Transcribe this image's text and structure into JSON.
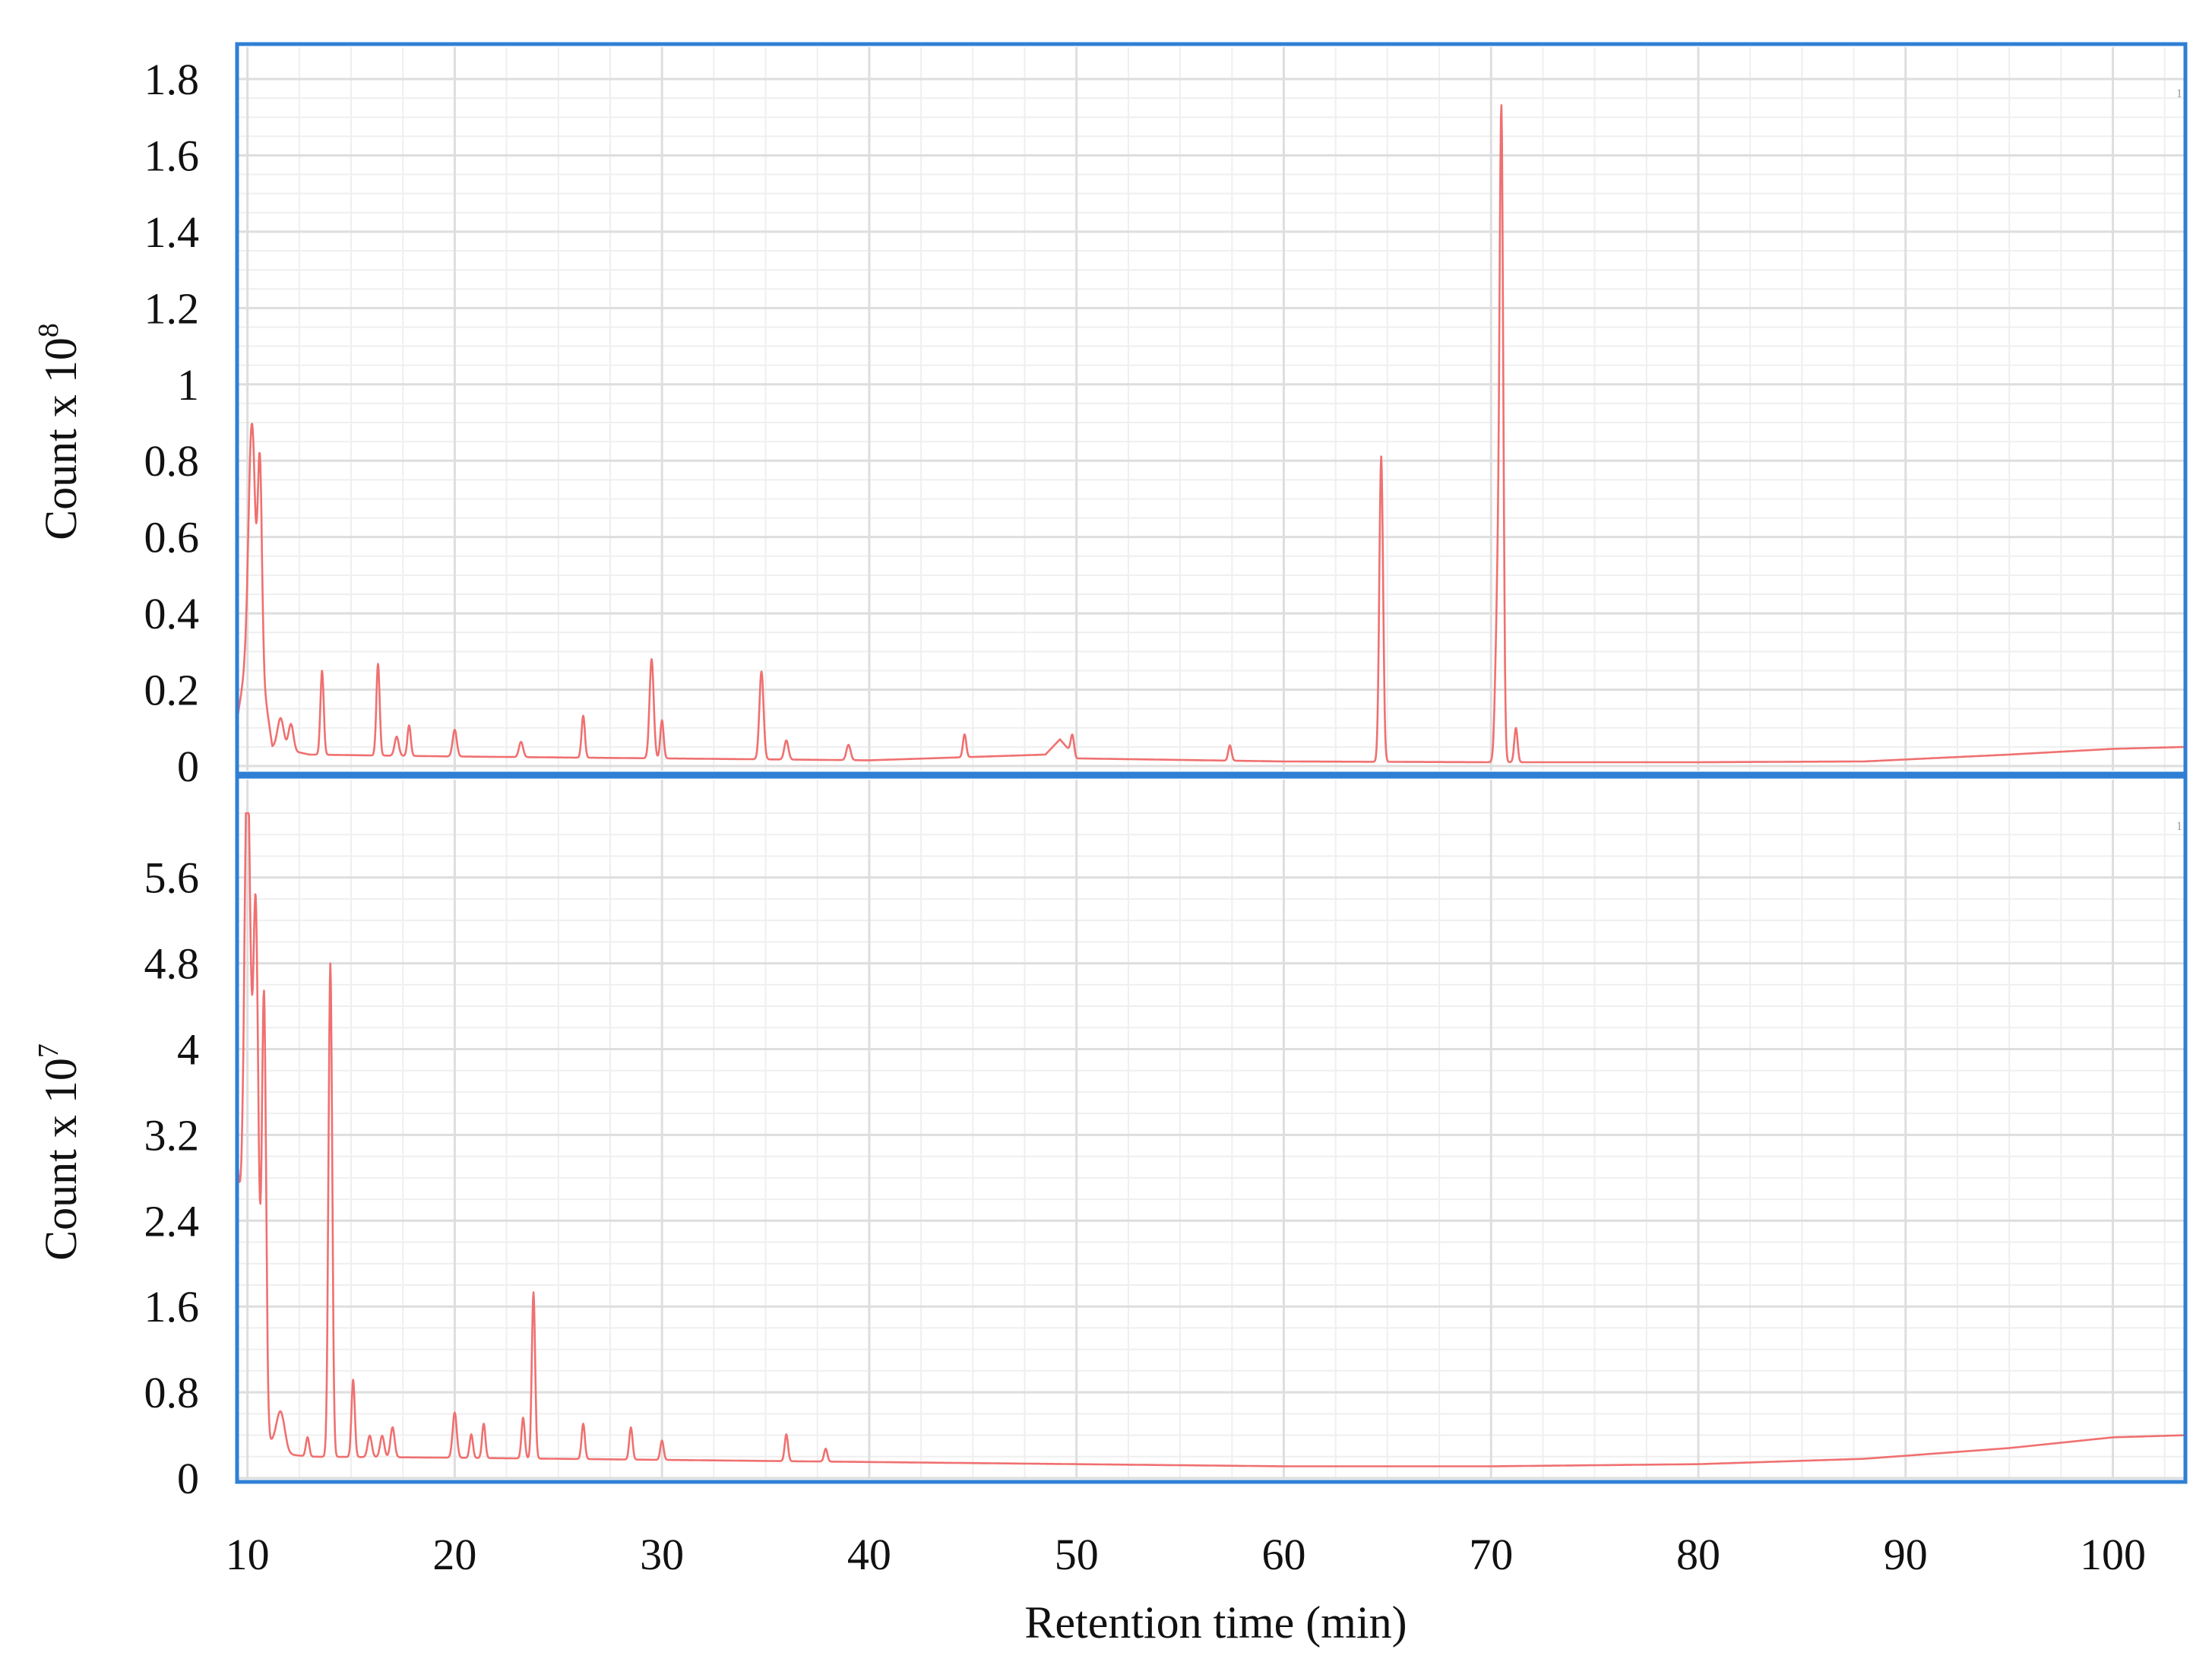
{
  "colors": {
    "frame": "#2f7fd4",
    "trace": "#f07070",
    "grid_major": "#dedede",
    "grid_minor": "#efefef"
  },
  "xaxis": {
    "label": "Retention time (min)",
    "ticks": [
      "10",
      "20",
      "30",
      "40",
      "50",
      "60",
      "70",
      "80",
      "90",
      "100"
    ],
    "range": [
      9.5,
      103.5
    ]
  },
  "chart_data": [
    {
      "type": "line",
      "ylabel": {
        "text": "Count x 10",
        "exp": "8"
      },
      "corner_marker": "1",
      "ylim": [
        0,
        1.8
      ],
      "yticks": [
        0,
        0.2,
        0.4,
        0.6,
        0.8,
        1.0,
        1.2,
        1.4,
        1.6,
        1.8
      ],
      "ytick_labels": [
        "0",
        "0.2",
        "0.4",
        "0.6",
        "0.8",
        "1",
        "1.2",
        "1.4",
        "1.6",
        "1.8"
      ],
      "baseline": [
        [
          9.5,
          0.12
        ],
        [
          10.3,
          0.4
        ],
        [
          11.2,
          0.05
        ],
        [
          13,
          0.03
        ],
        [
          20,
          0.025
        ],
        [
          30,
          0.02
        ],
        [
          40,
          0.015
        ],
        [
          48.5,
          0.03
        ],
        [
          49.2,
          0.07
        ],
        [
          50,
          0.02
        ],
        [
          60,
          0.012
        ],
        [
          70,
          0.01
        ],
        [
          80,
          0.01
        ],
        [
          88,
          0.012
        ],
        [
          95,
          0.03
        ],
        [
          100,
          0.045
        ],
        [
          103.5,
          0.05
        ]
      ],
      "peaks": [
        [
          10.2,
          0.53,
          0.15
        ],
        [
          10.6,
          0.52,
          0.1
        ],
        [
          11.6,
          0.08,
          0.15
        ],
        [
          12.1,
          0.07,
          0.12
        ],
        [
          13.6,
          0.22,
          0.08
        ],
        [
          16.3,
          0.24,
          0.08
        ],
        [
          17.2,
          0.05,
          0.1
        ],
        [
          17.8,
          0.08,
          0.08
        ],
        [
          20.0,
          0.07,
          0.1
        ],
        [
          23.2,
          0.04,
          0.1
        ],
        [
          26.2,
          0.11,
          0.08
        ],
        [
          29.5,
          0.26,
          0.1
        ],
        [
          30.0,
          0.1,
          0.08
        ],
        [
          34.8,
          0.23,
          0.1
        ],
        [
          36.0,
          0.05,
          0.1
        ],
        [
          39.0,
          0.04,
          0.1
        ],
        [
          44.6,
          0.06,
          0.08
        ],
        [
          49.8,
          0.05,
          0.08
        ],
        [
          57.4,
          0.04,
          0.08
        ],
        [
          64.7,
          0.8,
          0.09
        ],
        [
          70.3,
          0.38,
          0.1
        ],
        [
          70.5,
          1.67,
          0.09
        ],
        [
          71.2,
          0.09,
          0.08
        ]
      ]
    },
    {
      "type": "line",
      "ylabel": {
        "text": "Count x 10",
        "exp": "7"
      },
      "corner_marker": "1",
      "ylim": [
        0,
        6.2
      ],
      "yticks": [
        0,
        0.8,
        1.6,
        2.4,
        3.2,
        4.0,
        4.8,
        5.6
      ],
      "ytick_labels": [
        "0",
        "0.8",
        "1.6",
        "2.4",
        "3.2",
        "4",
        "4.8",
        "5.6"
      ],
      "baseline": [
        [
          9.5,
          3.0
        ],
        [
          9.8,
          1.9
        ],
        [
          10.5,
          1.3
        ],
        [
          11.0,
          0.35
        ],
        [
          12,
          0.22
        ],
        [
          13,
          0.2
        ],
        [
          20,
          0.19
        ],
        [
          30,
          0.17
        ],
        [
          40,
          0.15
        ],
        [
          50,
          0.13
        ],
        [
          60,
          0.11
        ],
        [
          70,
          0.11
        ],
        [
          80,
          0.13
        ],
        [
          88,
          0.18
        ],
        [
          95,
          0.28
        ],
        [
          100,
          0.38
        ],
        [
          103.5,
          0.4
        ]
      ],
      "peaks": [
        [
          10.0,
          5.0,
          0.15
        ],
        [
          10.4,
          3.9,
          0.12
        ],
        [
          10.8,
          3.8,
          0.1
        ],
        [
          11.6,
          0.35,
          0.2
        ],
        [
          12.9,
          0.18,
          0.08
        ],
        [
          14.0,
          4.6,
          0.09
        ],
        [
          15.1,
          0.72,
          0.08
        ],
        [
          15.9,
          0.2,
          0.1
        ],
        [
          16.5,
          0.2,
          0.1
        ],
        [
          17.0,
          0.28,
          0.1
        ],
        [
          20.0,
          0.42,
          0.1
        ],
        [
          20.8,
          0.22,
          0.08
        ],
        [
          21.4,
          0.32,
          0.08
        ],
        [
          23.3,
          0.38,
          0.08
        ],
        [
          23.8,
          1.55,
          0.08
        ],
        [
          26.2,
          0.33,
          0.08
        ],
        [
          28.5,
          0.3,
          0.08
        ],
        [
          30.0,
          0.18,
          0.08
        ],
        [
          36.0,
          0.25,
          0.08
        ],
        [
          37.9,
          0.12,
          0.08
        ]
      ]
    }
  ]
}
